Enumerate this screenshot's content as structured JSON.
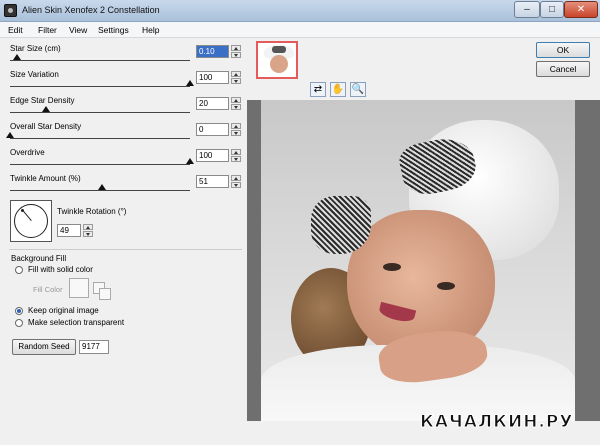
{
  "window": {
    "title": "Alien Skin Xenofex 2 Constellation",
    "min_glyph": "–",
    "max_glyph": "□",
    "close_glyph": "✕"
  },
  "menu": [
    "Edit",
    "Filter",
    "View",
    "Settings",
    "Help"
  ],
  "params": [
    {
      "label": "Star Size (cm)",
      "value": "0.10",
      "slider_fraction": 0.04,
      "selected": true
    },
    {
      "label": "Size Variation",
      "value": "100",
      "slider_fraction": 1.0
    },
    {
      "label": "Edge Star Density",
      "value": "20",
      "slider_fraction": 0.2
    },
    {
      "label": "Overall Star Density",
      "value": "0",
      "slider_fraction": 0.0
    },
    {
      "label": "Overdrive",
      "value": "100",
      "slider_fraction": 1.0
    },
    {
      "label": "Twinkle Amount (%)",
      "value": "51",
      "slider_fraction": 0.51
    }
  ],
  "twinkle_rotation": {
    "label": "Twinkle Rotation (°)",
    "value": "49"
  },
  "background_fill": {
    "title": "Background Fill",
    "options": [
      {
        "label": "Fill with solid color",
        "selected": false
      },
      {
        "label": "Keep original image",
        "selected": true
      },
      {
        "label": "Make selection transparent",
        "selected": false
      }
    ],
    "fill_color_label": "Fill Color"
  },
  "random_seed": {
    "button_label": "Random Seed",
    "value": "9177"
  },
  "buttons": {
    "ok": "OK",
    "cancel": "Cancel"
  },
  "tools": {
    "hand_glyph": "✋",
    "zoom_glyph": "🔍",
    "nav_glyph": "⇄"
  },
  "watermark": "КАЧАЛКИН.РУ",
  "colors": {
    "accent": "#3a6fc6",
    "thumbnail_border": "#e55a5a"
  }
}
